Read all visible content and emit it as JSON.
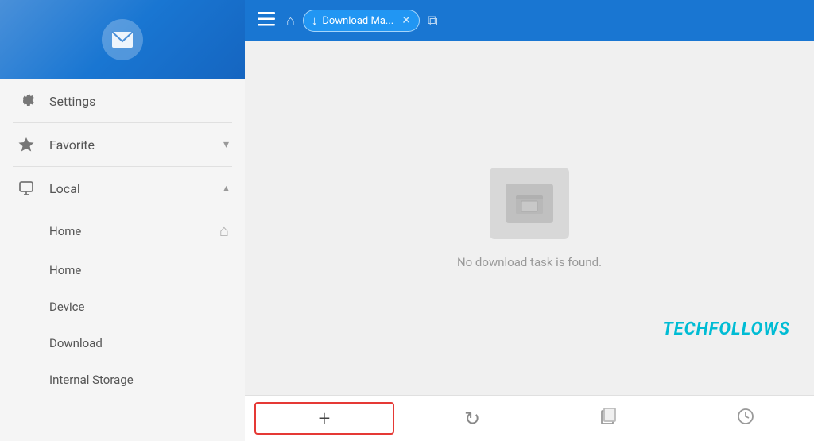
{
  "sidebar": {
    "header": {
      "icon": "mail"
    },
    "nav": [
      {
        "id": "settings",
        "label": "Settings",
        "icon": "gear",
        "hasArrow": false
      },
      {
        "id": "favorite",
        "label": "Favorite",
        "icon": "star",
        "hasArrow": true,
        "arrowDown": true
      },
      {
        "id": "local",
        "label": "Local",
        "icon": "device",
        "hasArrow": true,
        "arrowUp": true
      }
    ],
    "subitems": [
      {
        "id": "home1",
        "label": "Home",
        "hasHomeIcon": true
      },
      {
        "id": "home2",
        "label": "Home",
        "hasHomeIcon": false
      },
      {
        "id": "device",
        "label": "Device",
        "hasHomeIcon": false
      },
      {
        "id": "download",
        "label": "Download",
        "hasHomeIcon": false
      },
      {
        "id": "internal-storage",
        "label": "Internal Storage",
        "hasHomeIcon": false
      }
    ]
  },
  "topbar": {
    "tab_label": "Download Ma...",
    "home_label": "⌂"
  },
  "content": {
    "empty_message": "No download task is found."
  },
  "watermark": "TECHFOLLOWS",
  "bottombar": {
    "add_label": "+",
    "refresh_label": "↻",
    "files_label": "❏",
    "history_label": "⏱"
  }
}
